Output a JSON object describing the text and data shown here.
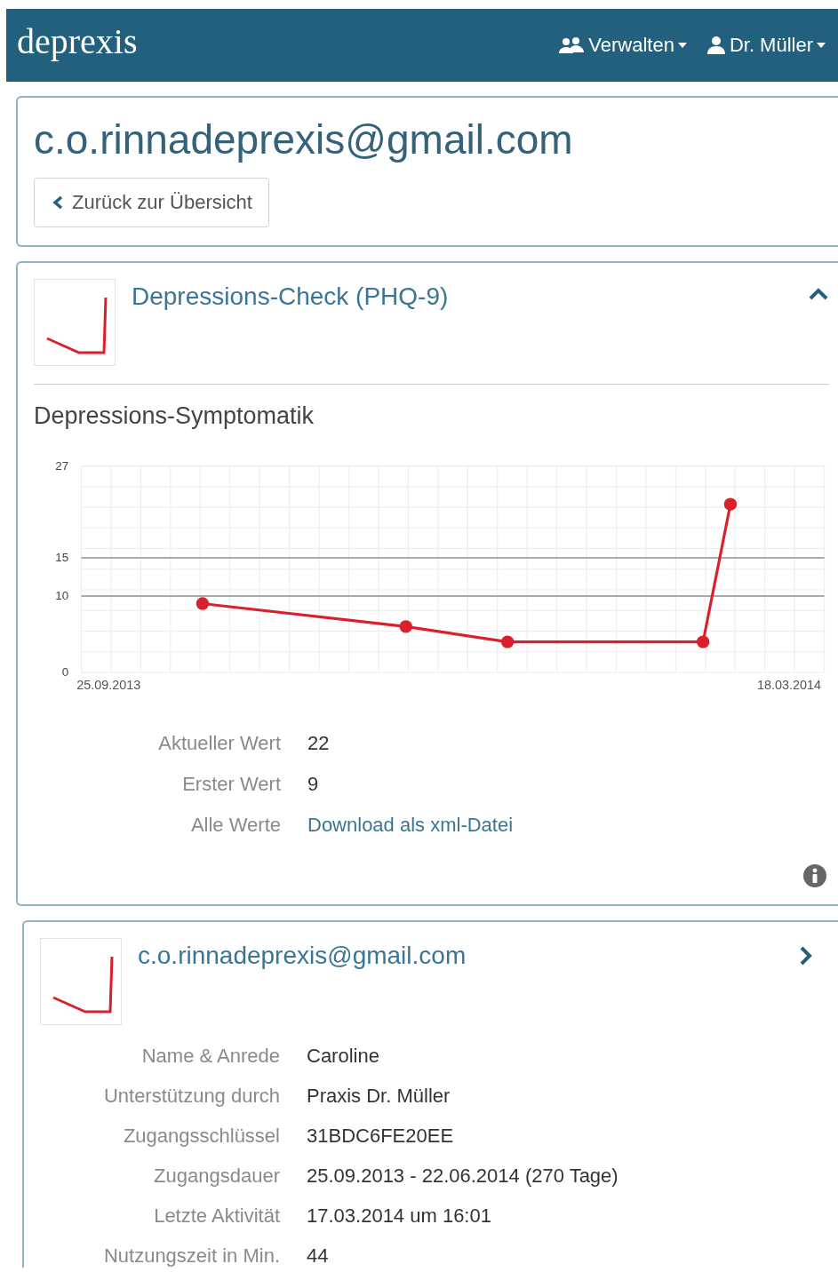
{
  "navbar": {
    "logo": "deprexis",
    "menus": [
      {
        "kind": "group",
        "label": "Verwalten"
      },
      {
        "kind": "user",
        "label": "Dr. Müller"
      }
    ]
  },
  "patient_header": {
    "title": "c.o.rinnadeprexis@gmail.com",
    "back_button": "Zurück zur Übersicht"
  },
  "check_card": {
    "title": "Depressions-Check (PHQ-9)",
    "expanded": true,
    "section_title": "Depressions-Symptomatik",
    "chart_data": {
      "type": "line",
      "grid": true,
      "x": [
        "2013-10-19",
        "2013-12-10",
        "2014-01-05",
        "2014-02-24",
        "2014-03-03"
      ],
      "series": [
        {
          "color": "#d9202b",
          "marker": "circle",
          "values": [
            9,
            6,
            4,
            4,
            22
          ]
        }
      ],
      "xlim": [
        "2013-09-18",
        "2014-03-27"
      ],
      "ylim": [
        0,
        27
      ],
      "xticks": [
        {
          "value": "2013-09-25",
          "label": "25.09.2013"
        },
        {
          "value": "2014-03-18",
          "label": "18.03.2014"
        }
      ],
      "yticks": [
        0,
        10,
        15,
        27
      ]
    },
    "details": [
      {
        "kind": "text",
        "label": "Aktueller Wert",
        "value": "22"
      },
      {
        "kind": "text",
        "label": "Erster Wert",
        "value": "9"
      },
      {
        "kind": "link",
        "label": "Alle Werte",
        "value": "Download als xml-Datei"
      }
    ]
  },
  "patient_card": {
    "title": "c.o.rinnadeprexis@gmail.com",
    "expanded": false,
    "details": [
      {
        "kind": "text",
        "label": "Name & Anrede",
        "value": "Caroline"
      },
      {
        "kind": "text",
        "label": "Unterstützung durch",
        "value": "Praxis Dr. Müller"
      },
      {
        "kind": "text",
        "label": "Zugangsschlüssel",
        "value": "31BDC6FE20EE"
      },
      {
        "kind": "text",
        "label": "Zugangsdauer",
        "value": "25.09.2013 - 22.06.2014 (270 Tage)"
      },
      {
        "kind": "text",
        "label": "Letzte Aktivität",
        "value": "17.03.2014 um 16:01"
      },
      {
        "kind": "text",
        "label": "Nutzungszeit in Min.",
        "value": "44"
      }
    ]
  }
}
